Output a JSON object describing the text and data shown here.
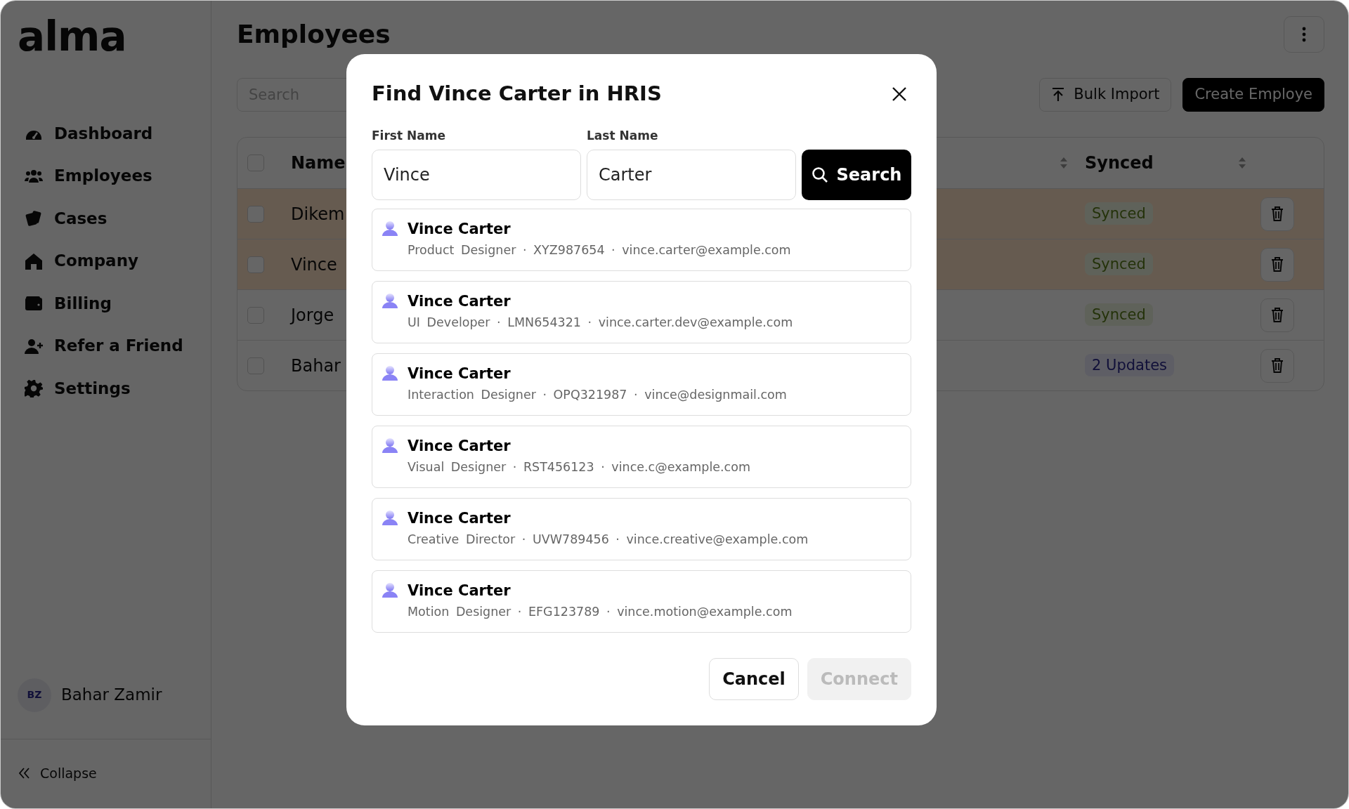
{
  "sidebar": {
    "logo": "alma",
    "items": [
      {
        "label": "Dashboard",
        "kind": "gauge",
        "selected": false
      },
      {
        "label": "Employees",
        "kind": "people",
        "selected": false
      },
      {
        "label": "Cases",
        "kind": "cards",
        "selected": false
      },
      {
        "label": "Company",
        "kind": "house",
        "selected": false
      },
      {
        "label": "Billing",
        "kind": "wallet",
        "selected": false
      },
      {
        "label": "Refer a Friend",
        "kind": "user-plus",
        "selected": false
      },
      {
        "label": "Settings",
        "kind": "gear",
        "selected": false
      }
    ],
    "user": {
      "initials": "BZ",
      "name": "Bahar Zamir"
    },
    "collapse": "Collapse"
  },
  "page": {
    "title": "Employees",
    "search": {
      "placeholder": "Search"
    },
    "actions": [
      {
        "label": "Bulk Import",
        "kind": "outline"
      },
      {
        "label": "Create Employe",
        "kind": "primary"
      }
    ]
  },
  "table": {
    "select_all": {
      "checked": false
    },
    "columns": [
      {
        "label": "Name"
      },
      {
        "label": "Synced"
      }
    ],
    "rows": [
      {
        "name": "Dikem",
        "status": "Synced",
        "kind": "synced",
        "highlighted": true,
        "checked": false
      },
      {
        "name": "Vince",
        "status": "Synced",
        "kind": "synced",
        "highlighted": true,
        "checked": false
      },
      {
        "name": "Jorge",
        "status": "Synced",
        "kind": "synced",
        "highlighted": false,
        "checked": false
      },
      {
        "name": "Bahar",
        "status": "2 Updates",
        "kind": "updates",
        "highlighted": false,
        "checked": false
      }
    ]
  },
  "modal": {
    "title": "Find Vince Carter in HRIS",
    "fields": [
      {
        "label": "First Name",
        "value": "Vince"
      },
      {
        "label": "Last Name",
        "value": "Carter"
      }
    ],
    "search_button": "Search",
    "results": [
      {
        "name": "Vince Carter",
        "details": "Product Designer · XYZ987654 · vince.carter@example.com",
        "selected": false
      },
      {
        "name": "Vince Carter",
        "details": "UI Developer · LMN654321 · vince.carter.dev@example.com",
        "selected": false
      },
      {
        "name": "Vince Carter",
        "details": "Interaction Designer · OPQ321987 · vince@designmail.com",
        "selected": false
      },
      {
        "name": "Vince Carter",
        "details": "Visual Designer · RST456123 · vince.c@example.com",
        "selected": false
      },
      {
        "name": "Vince Carter",
        "details": "Creative Director · UVW789456 · vince.creative@example.com",
        "selected": false
      },
      {
        "name": "Vince Carter",
        "details": "Motion Designer · EFG123789 · vince.motion@example.com",
        "selected": false
      }
    ],
    "buttons": [
      {
        "label": "Cancel",
        "kind": "outline",
        "disabled": false
      },
      {
        "label": "Connect",
        "kind": "primary",
        "disabled": true
      }
    ]
  }
}
